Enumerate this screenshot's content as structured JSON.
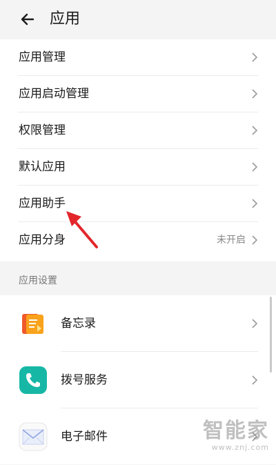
{
  "header": {
    "title": "应用"
  },
  "main_menu": [
    {
      "label": "应用管理",
      "value": ""
    },
    {
      "label": "应用启动管理",
      "value": ""
    },
    {
      "label": "权限管理",
      "value": ""
    },
    {
      "label": "默认应用",
      "value": ""
    },
    {
      "label": "应用助手",
      "value": ""
    },
    {
      "label": "应用分身",
      "value": "未开启"
    }
  ],
  "app_settings": {
    "title": "应用设置",
    "items": [
      {
        "label": "备忘录",
        "icon": "memo-icon"
      },
      {
        "label": "拨号服务",
        "icon": "phone-icon"
      },
      {
        "label": "电子邮件",
        "icon": "email-icon"
      }
    ]
  },
  "watermark": {
    "logo_text": "智能家",
    "url": "www.znj.com"
  },
  "colors": {
    "annotation_arrow": "#e2262b",
    "phone_icon": "#17b7a6",
    "memo_icon": "#f28a1f"
  }
}
